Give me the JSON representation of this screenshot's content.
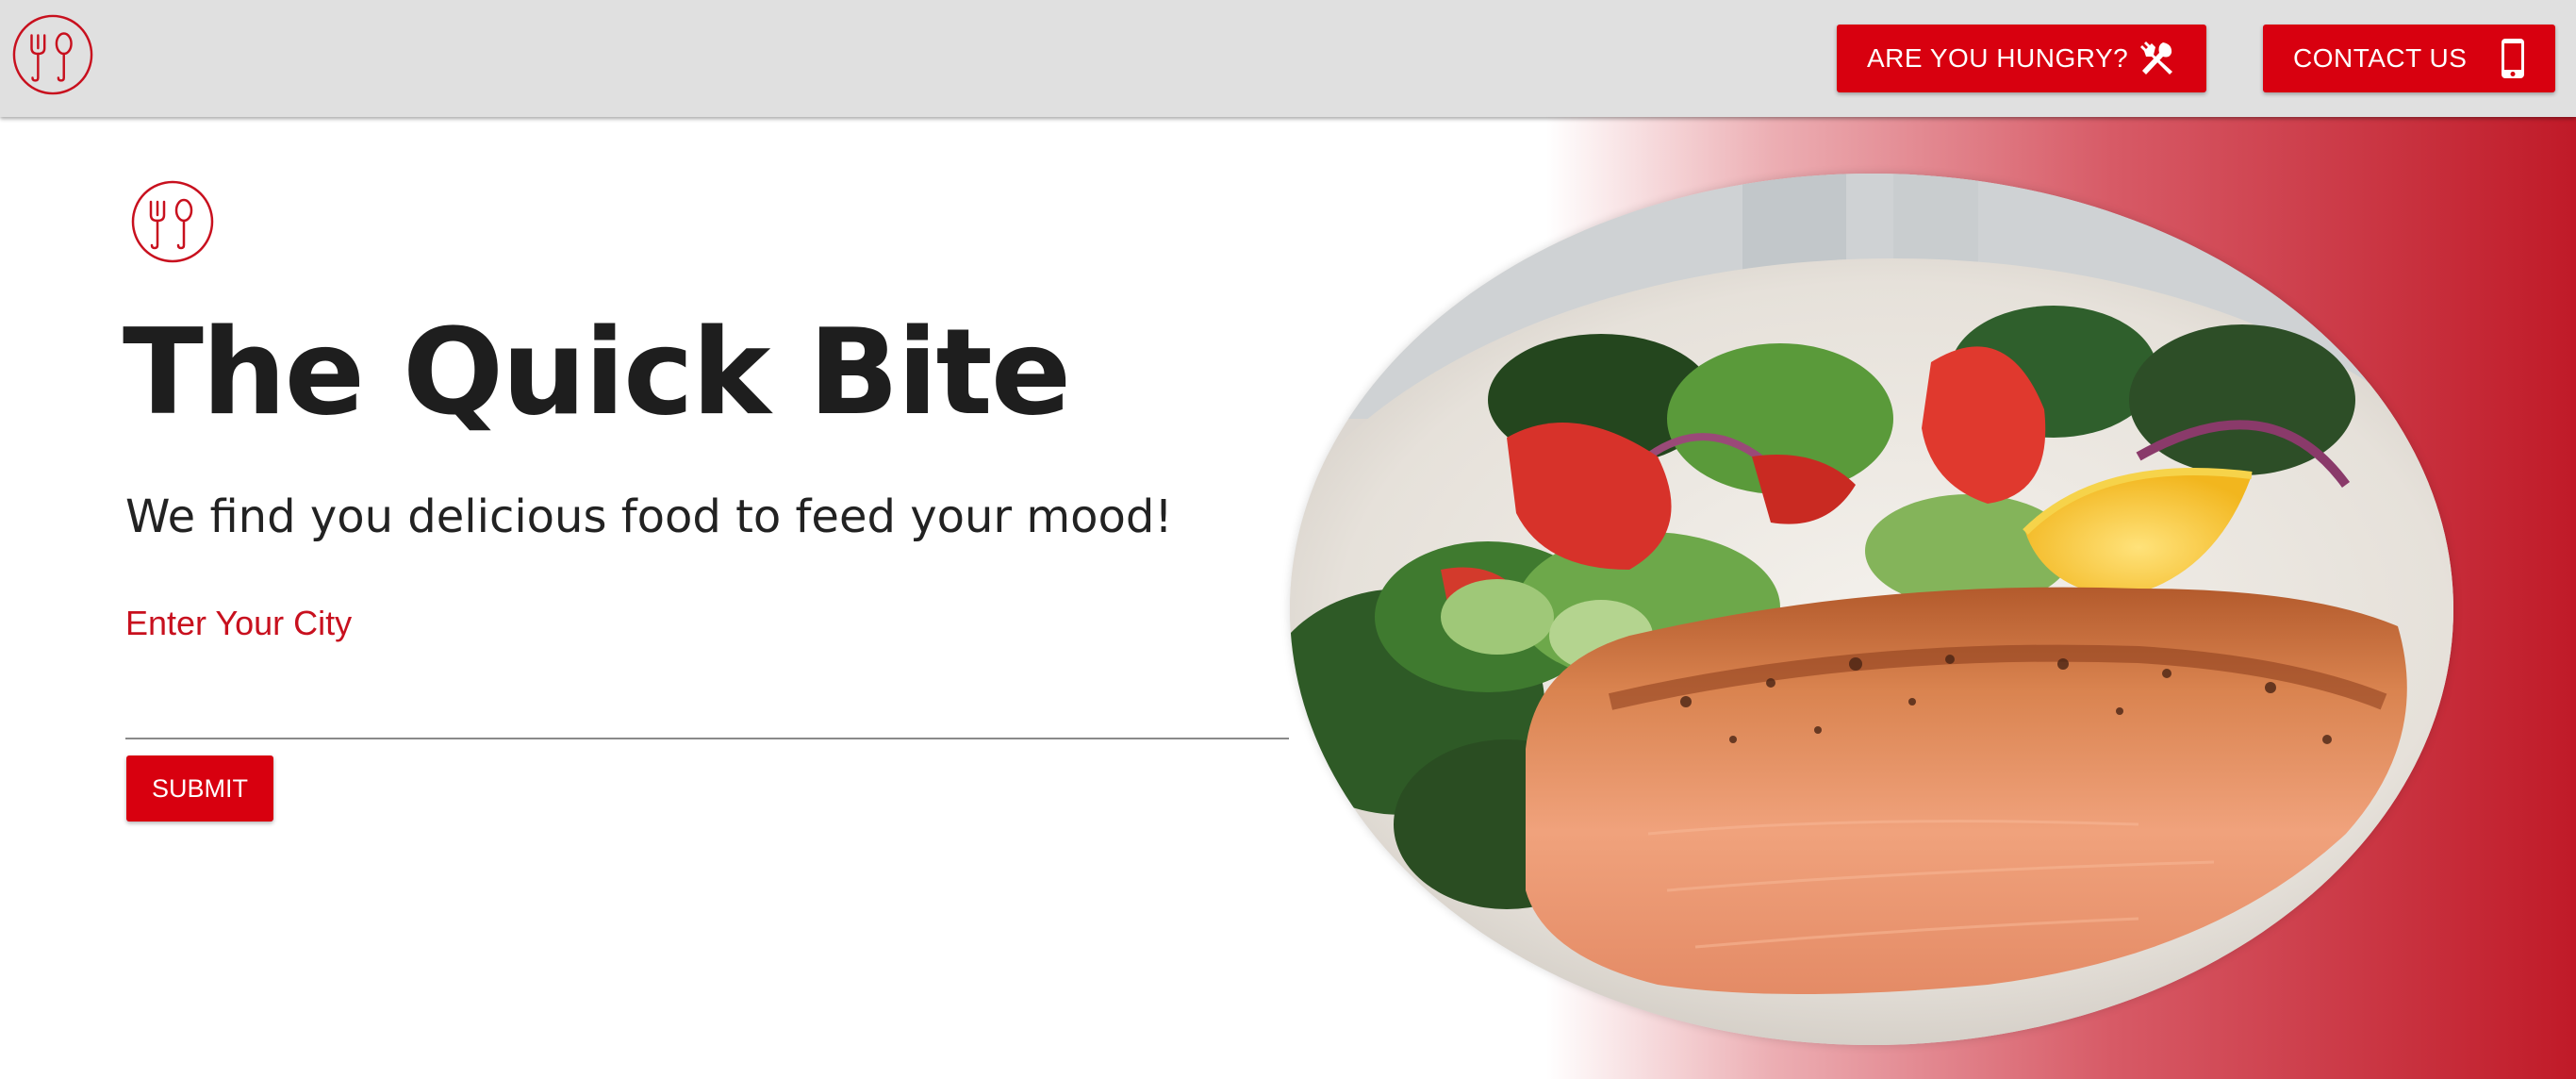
{
  "header": {
    "logo_icon": "fork-spoon-logo-icon",
    "nav": {
      "hungry_label": "ARE YOU HUNGRY?",
      "hungry_icon": "cutlery-cross-icon",
      "contact_label": "CONTACT US",
      "contact_icon": "mobile-phone-icon"
    }
  },
  "hero": {
    "logo_icon": "fork-spoon-logo-icon",
    "title": "The Quick Bite",
    "subtitle": "We find you delicious food to feed your mood!",
    "city_label": "Enter Your City",
    "city_value": "",
    "city_placeholder": "",
    "submit_label": "SUBMIT",
    "image": "salmon-salad-plate-photo"
  },
  "colors": {
    "accent_red": "#d8000f",
    "topbar_gray": "#e0e0e0",
    "title_dark": "#1e1e1e",
    "gradient_end": "#c01a28"
  }
}
